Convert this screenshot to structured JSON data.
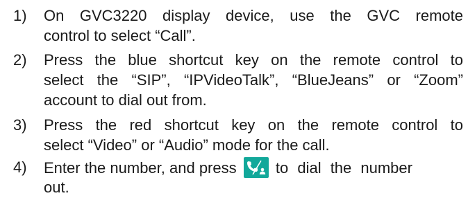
{
  "steps": [
    {
      "number": "1)",
      "lines": [
        "On GVC3220 display device, use the GVC remote",
        "control to select “Call”."
      ]
    },
    {
      "number": "2)",
      "lines": [
        "Press the blue shortcut key on the remote control to",
        "select the “SIP”, “IPVideoTalk”, “BlueJeans” or “Zoom”",
        "account to dial out from."
      ]
    },
    {
      "number": "3)",
      "lines": [
        "Press the red shortcut key on the remote control to",
        "select “Video” or “Audio” mode for the call."
      ]
    },
    {
      "number": "4)",
      "line1_before_icon": "Enter the number, and press",
      "line1_after_icon": "to dial the number",
      "line2": "out.",
      "icon": "phone-dial-icon",
      "icon_color": "#12a89a"
    }
  ]
}
